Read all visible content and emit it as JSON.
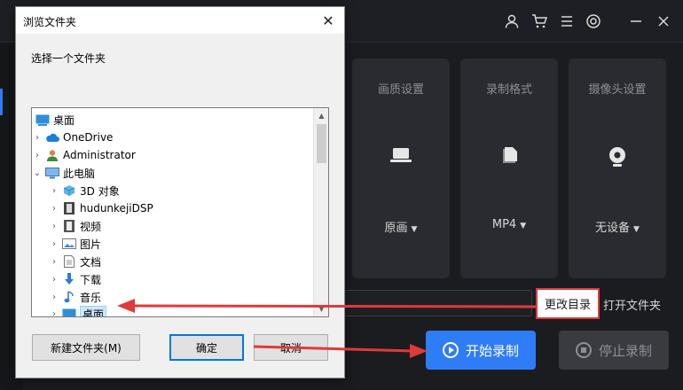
{
  "app": {
    "cards": [
      {
        "title": "画质设置",
        "value": "原画"
      },
      {
        "title": "录制格式",
        "value": "MP4"
      },
      {
        "title": "摄像头设置",
        "value": "无设备"
      }
    ],
    "change_dir_label": "更改目录",
    "open_folder_label": "打开文件夹",
    "start_label": "开始录制",
    "stop_label": "停止录制",
    "accent_color": "#2f7df6",
    "highlight_color": "#e03a3a",
    "top_icons": [
      "user-icon",
      "cart-icon",
      "menu-icon",
      "settings-icon",
      "minimize-icon",
      "close-icon"
    ]
  },
  "dialog": {
    "title": "浏览文件夹",
    "close_glyph": "✕",
    "prompt": "选择一个文件夹",
    "tree": [
      {
        "label": "桌面",
        "icon": "desktop-icon",
        "expander": "",
        "level": 0
      },
      {
        "label": "OneDrive",
        "icon": "cloud-icon",
        "expander": "›",
        "level": 1
      },
      {
        "label": "Administrator",
        "icon": "user-icon",
        "expander": "›",
        "level": 1
      },
      {
        "label": "此电脑",
        "icon": "computer-icon",
        "expander": "⌄",
        "level": 1
      },
      {
        "label": "3D 对象",
        "icon": "cube-icon",
        "expander": "›",
        "level": 2
      },
      {
        "label": "hudunkejiDSP",
        "icon": "film-icon",
        "expander": "›",
        "level": 2
      },
      {
        "label": "视频",
        "icon": "video-icon",
        "expander": "›",
        "level": 2
      },
      {
        "label": "图片",
        "icon": "image-icon",
        "expander": "›",
        "level": 2
      },
      {
        "label": "文档",
        "icon": "document-icon",
        "expander": "›",
        "level": 2
      },
      {
        "label": "下载",
        "icon": "download-icon",
        "expander": "›",
        "level": 2
      },
      {
        "label": "音乐",
        "icon": "music-icon",
        "expander": "›",
        "level": 2
      },
      {
        "label": "桌面",
        "icon": "desktop-icon",
        "expander": "›",
        "level": 2,
        "selected": true
      }
    ],
    "new_folder_label": "新建文件夹(M)",
    "ok_label": "确定",
    "cancel_label": "取消"
  }
}
